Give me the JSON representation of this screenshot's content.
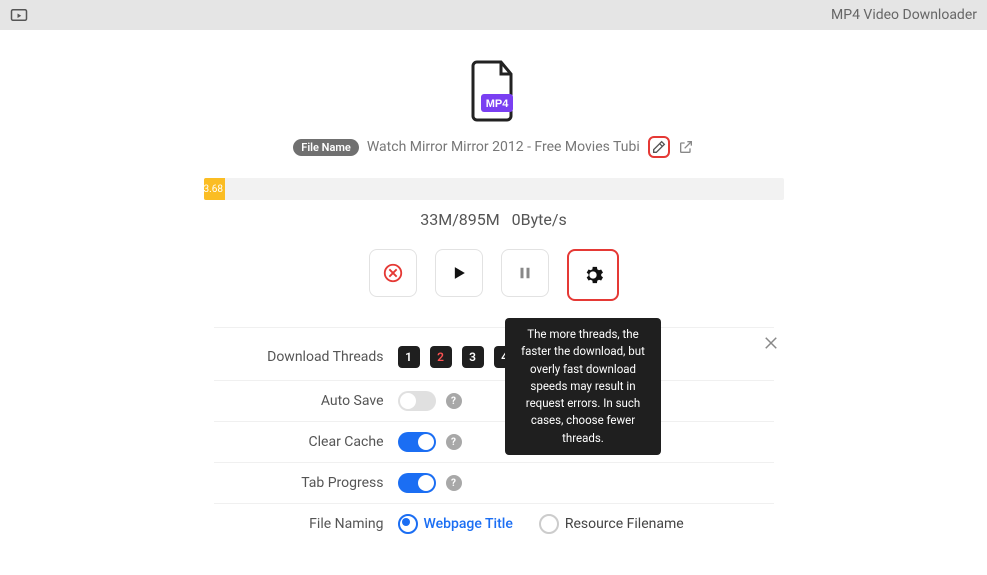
{
  "app": {
    "title": "MP4 Video Downloader"
  },
  "file": {
    "pill_label": "File Name",
    "name": "Watch Mirror Mirror 2012 - Free Movies Tubi"
  },
  "progress": {
    "percent_text": "3.68",
    "percent": 3.68
  },
  "stats": {
    "size": "33M/895M",
    "speed": "0Byte/s"
  },
  "threads": {
    "label": "Download Threads",
    "options": [
      "1",
      "2",
      "3",
      "4"
    ],
    "help_glyph": "?",
    "tooltip": "The more threads, the faster the download, but overly fast download speeds may result in request errors. In such cases, choose fewer threads."
  },
  "settings": {
    "auto_save_label": "Auto Save",
    "clear_cache_label": "Clear Cache",
    "tab_progress_label": "Tab Progress",
    "file_naming_label": "File Naming",
    "naming_options": {
      "webpage_title": "Webpage Title",
      "resource_filename": "Resource Filename"
    },
    "help_glyph": "?"
  }
}
